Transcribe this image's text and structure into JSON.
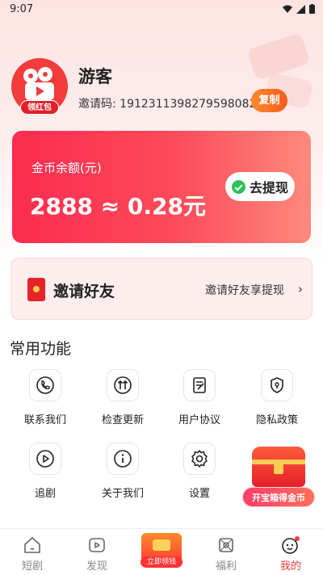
{
  "status_bar": {
    "time": "9:07"
  },
  "profile": {
    "avatar_badge": "领红包",
    "name": "游客",
    "invite_code": "邀请码: 1912311398279598082",
    "copy_label": "复制"
  },
  "balance": {
    "label": "金币余额(元)",
    "value": "2888 ≈ 0.28元",
    "withdraw_label": "去提现"
  },
  "invite": {
    "title": "邀请好友",
    "subtitle": "邀请好友享提现",
    "chevron": "›"
  },
  "functions": {
    "section_title": "常用功能",
    "items": [
      {
        "label": "联系我们",
        "icon": "phone-icon"
      },
      {
        "label": "检查更新",
        "icon": "update-icon"
      },
      {
        "label": "用户协议",
        "icon": "document-icon"
      },
      {
        "label": "隐私政策",
        "icon": "shield-icon"
      },
      {
        "label": "追剧",
        "icon": "play-icon"
      },
      {
        "label": "关于我们",
        "icon": "info-icon"
      },
      {
        "label": "设置",
        "icon": "gear-icon"
      }
    ]
  },
  "treasure": {
    "label": "开宝箱得金币"
  },
  "nav": {
    "items": [
      {
        "label": "短剧",
        "icon": "home-icon"
      },
      {
        "label": "发现",
        "icon": "play-box-icon"
      },
      {
        "label": "立即领钱",
        "icon": "red-packet-icon"
      },
      {
        "label": "福利",
        "icon": "gift-icon"
      },
      {
        "label": "我的",
        "icon": "profile-icon"
      }
    ],
    "active": "我的"
  },
  "colors": {
    "accent": "#f23b3b",
    "card_start": "#fb2c4f",
    "card_end": "#ff8a7d",
    "copy_button": "#f65b1f"
  }
}
